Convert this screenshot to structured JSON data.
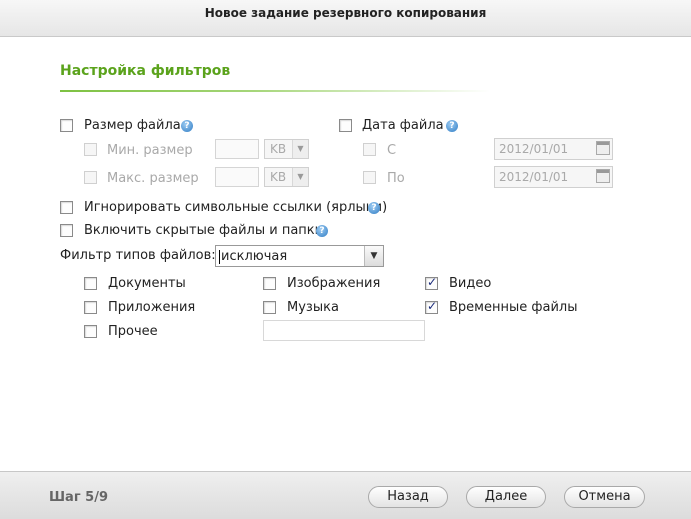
{
  "window": {
    "title": "Новое задание резервного копирования"
  },
  "section": {
    "title": "Настройка фильтров"
  },
  "file_size": {
    "label": "Размер файла",
    "checked": false,
    "min_label": "Мин. размер",
    "min_value": "",
    "min_unit": "KB",
    "max_label": "Макс. размер",
    "max_value": "",
    "max_unit": "KB"
  },
  "file_date": {
    "label": "Дата файла",
    "checked": false,
    "from_label": "С",
    "from_value": "2012/01/01",
    "to_label": "По",
    "to_value": "2012/01/01"
  },
  "options": {
    "ignore_symlinks": "Игнорировать символьные ссылки (ярлыки)",
    "include_hidden": "Включить скрытые файлы и папки."
  },
  "file_type_filter": {
    "label": "Фильтр типов файлов:",
    "value": "исключая"
  },
  "file_types": {
    "documents": {
      "label": "Документы",
      "checked": false
    },
    "images": {
      "label": "Изображения",
      "checked": false
    },
    "video": {
      "label": "Видео",
      "checked": true
    },
    "applications": {
      "label": "Приложения",
      "checked": false
    },
    "music": {
      "label": "Музыка",
      "checked": false
    },
    "temp_files": {
      "label": "Временные файлы",
      "checked": true
    },
    "other": {
      "label": "Прочее",
      "checked": false,
      "value": ""
    }
  },
  "footer": {
    "step": "Шаг 5/9",
    "back": "Назад",
    "next": "Далее",
    "cancel": "Отмена"
  },
  "icons": {
    "help": "help-icon",
    "calendar": "calendar-icon",
    "dropdown": "chevron-down-icon",
    "check": "check-icon"
  },
  "colors": {
    "accent": "#5ba31c",
    "help": "#2f7cc4",
    "check": "#1a2a7a"
  }
}
